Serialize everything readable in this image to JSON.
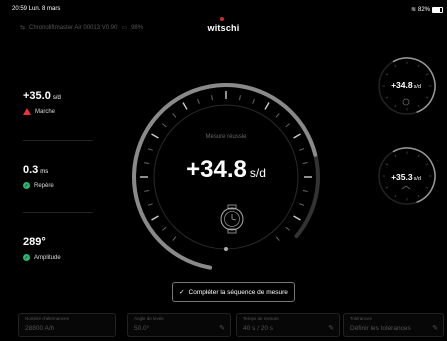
{
  "statusbar": {
    "time": "20:59  Lun. 8 mars",
    "wifi": "wifi",
    "battery": "82%"
  },
  "header": {
    "device": "Chronoliftmaster Air 00013 V0.90",
    "battery_pct": "98%",
    "logo": "witschi"
  },
  "metrics": {
    "rate": {
      "value": "+35.0",
      "unit": "s/d",
      "label": "Marche",
      "status": "warning"
    },
    "beat_error": {
      "value": "0.3",
      "unit": "ms",
      "label": "Repère",
      "status": "ok"
    },
    "amplitude": {
      "value": "289°",
      "label": "Amplitude",
      "status": "ok"
    }
  },
  "main_gauge": {
    "caption": "Mesure réussie",
    "value": "+34.8",
    "unit": "s/d",
    "progress": 0.82
  },
  "mini_gauges": [
    {
      "value": "+34.8",
      "unit": "s/d"
    },
    {
      "value": "+35.3",
      "unit": "s/d"
    }
  ],
  "cta": {
    "label": "Compléter la séquence de mesure"
  },
  "fields": [
    {
      "label": "Nombre d'alternances",
      "value": "28800 A/h",
      "editable": false
    },
    {
      "label": "Angle de levée",
      "value": "50.0°",
      "editable": true
    },
    {
      "label": "Temps de mesure",
      "value": "40 s / 20 s",
      "editable": true
    },
    {
      "label": "Tolérances",
      "value": "Définir les tolérances",
      "editable": true
    }
  ],
  "colors": {
    "ok": "#2bb673",
    "warning": "#e33333",
    "accent": "#d02b2b"
  }
}
